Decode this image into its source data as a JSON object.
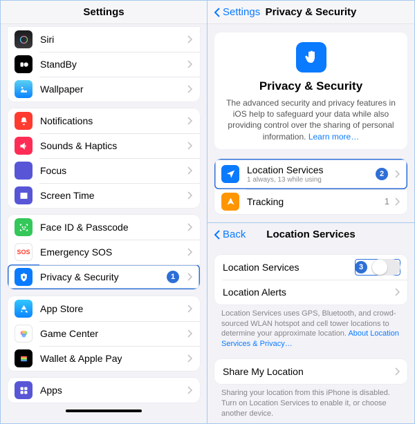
{
  "left": {
    "title": "Settings",
    "group1": [
      {
        "label": "Siri"
      },
      {
        "label": "StandBy"
      },
      {
        "label": "Wallpaper"
      }
    ],
    "group2": [
      {
        "label": "Notifications"
      },
      {
        "label": "Sounds & Haptics"
      },
      {
        "label": "Focus"
      },
      {
        "label": "Screen Time"
      }
    ],
    "group3": [
      {
        "label": "Face ID & Passcode"
      },
      {
        "label": "Emergency SOS"
      },
      {
        "label": "Privacy & Security"
      }
    ],
    "group4": [
      {
        "label": "App Store"
      },
      {
        "label": "Game Center"
      },
      {
        "label": "Wallet & Apple Pay"
      }
    ],
    "group5": [
      {
        "label": "Apps"
      }
    ]
  },
  "top": {
    "back": "Settings",
    "title": "Privacy & Security",
    "hero_title": "Privacy & Security",
    "hero_body": "The advanced security and privacy features in iOS help to safeguard your data while also providing control over the sharing of personal information. ",
    "hero_link": "Learn more…",
    "rows": {
      "loc": {
        "label": "Location Services",
        "sub": "1 always, 13 while using"
      },
      "track": {
        "label": "Tracking",
        "detail": "1"
      }
    }
  },
  "bot": {
    "back": "Back",
    "title": "Location Services",
    "row_loc": "Location Services",
    "row_alerts": "Location Alerts",
    "foot1a": "Location Services uses GPS, Bluetooth, and crowd-sourced WLAN hotspot and cell tower locations to determine your approximate location. ",
    "foot1b": "About Location Services & Privacy…",
    "row_share": "Share My Location",
    "foot2": "Sharing your location from this iPhone is disabled. Turn on Location Services to enable it, or choose another device."
  },
  "steps": {
    "s1": "1",
    "s2": "2",
    "s3": "3"
  }
}
